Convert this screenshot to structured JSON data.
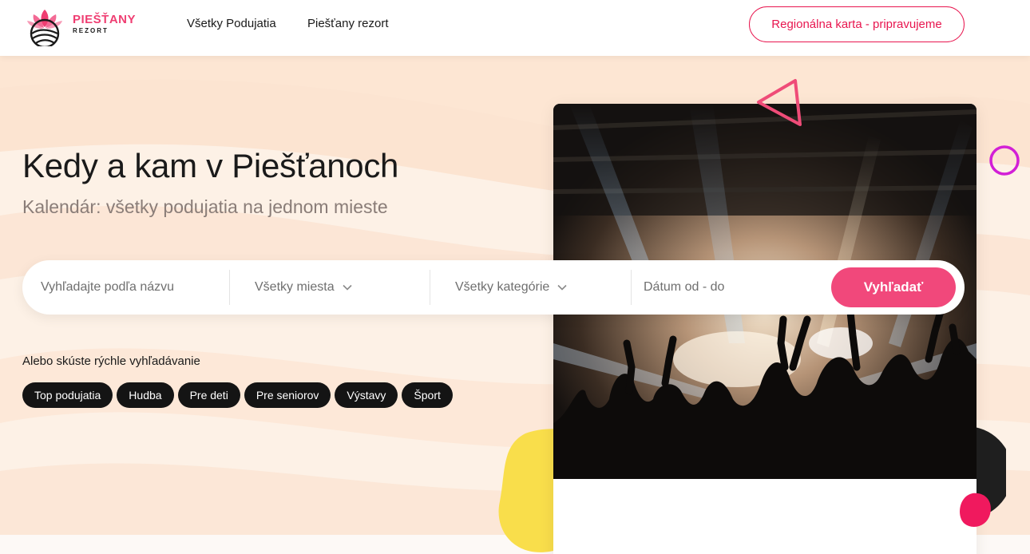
{
  "header": {
    "logo": {
      "name": "PIEŠŤANY",
      "sub": "REZORT"
    },
    "nav": [
      "Všetky Podujatia",
      "Piešťany rezort"
    ],
    "cta_label": "Regionálna karta - pripravujeme"
  },
  "hero": {
    "title": "Kedy a kam v Piešťanoch",
    "subtitle": "Kalendár: všetky podujatia na jednom mieste"
  },
  "search": {
    "name_placeholder": "Vyhľadajte podľa názvu",
    "location_label": "Všetky miesta",
    "category_label": "Všetky kategórie",
    "date_placeholder": "Dátum od - do",
    "button_label": "Vyhľadať"
  },
  "quick": {
    "title": "Alebo skúste rýchle vyhľadávanie",
    "tags": [
      "Top podujatia",
      "Hudba",
      "Pre deti",
      "Pre seniorov",
      "Výstavy",
      "Šport"
    ]
  },
  "colors": {
    "accent": "#f1487b",
    "cta_border": "#e8164f",
    "yellow": "#f9de4b",
    "purple": "#d21fd6",
    "background": "#fdf1e6"
  }
}
